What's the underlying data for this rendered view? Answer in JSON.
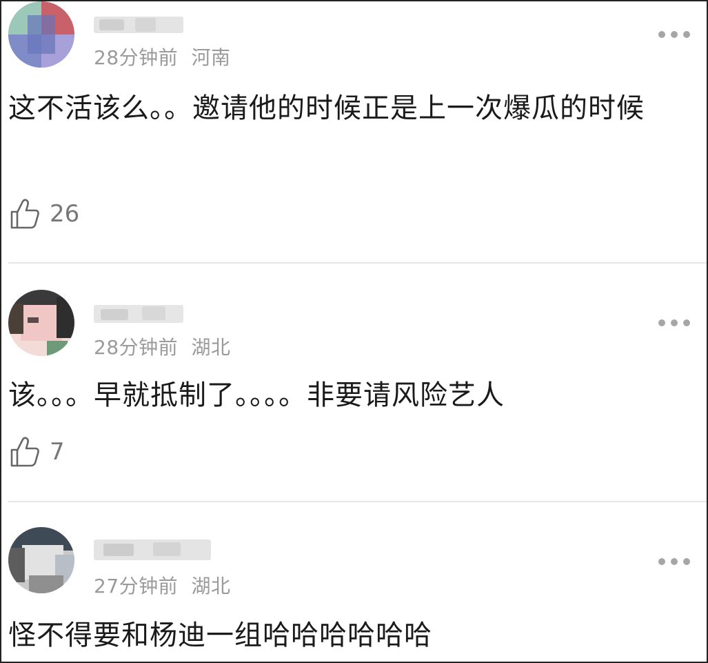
{
  "comments": [
    {
      "time": "28分钟前",
      "location": "河南",
      "text": "这不活该么。。邀请他的时候正是上一次爆瓜的时候",
      "likes": "26"
    },
    {
      "time": "28分钟前",
      "location": "湖北",
      "text": "该。。。早就抵制了。。。。非要请风险艺人",
      "likes": "7"
    },
    {
      "time": "27分钟前",
      "location": "湖北",
      "text": "怪不得要和杨迪一组哈哈哈哈哈哈"
    }
  ]
}
